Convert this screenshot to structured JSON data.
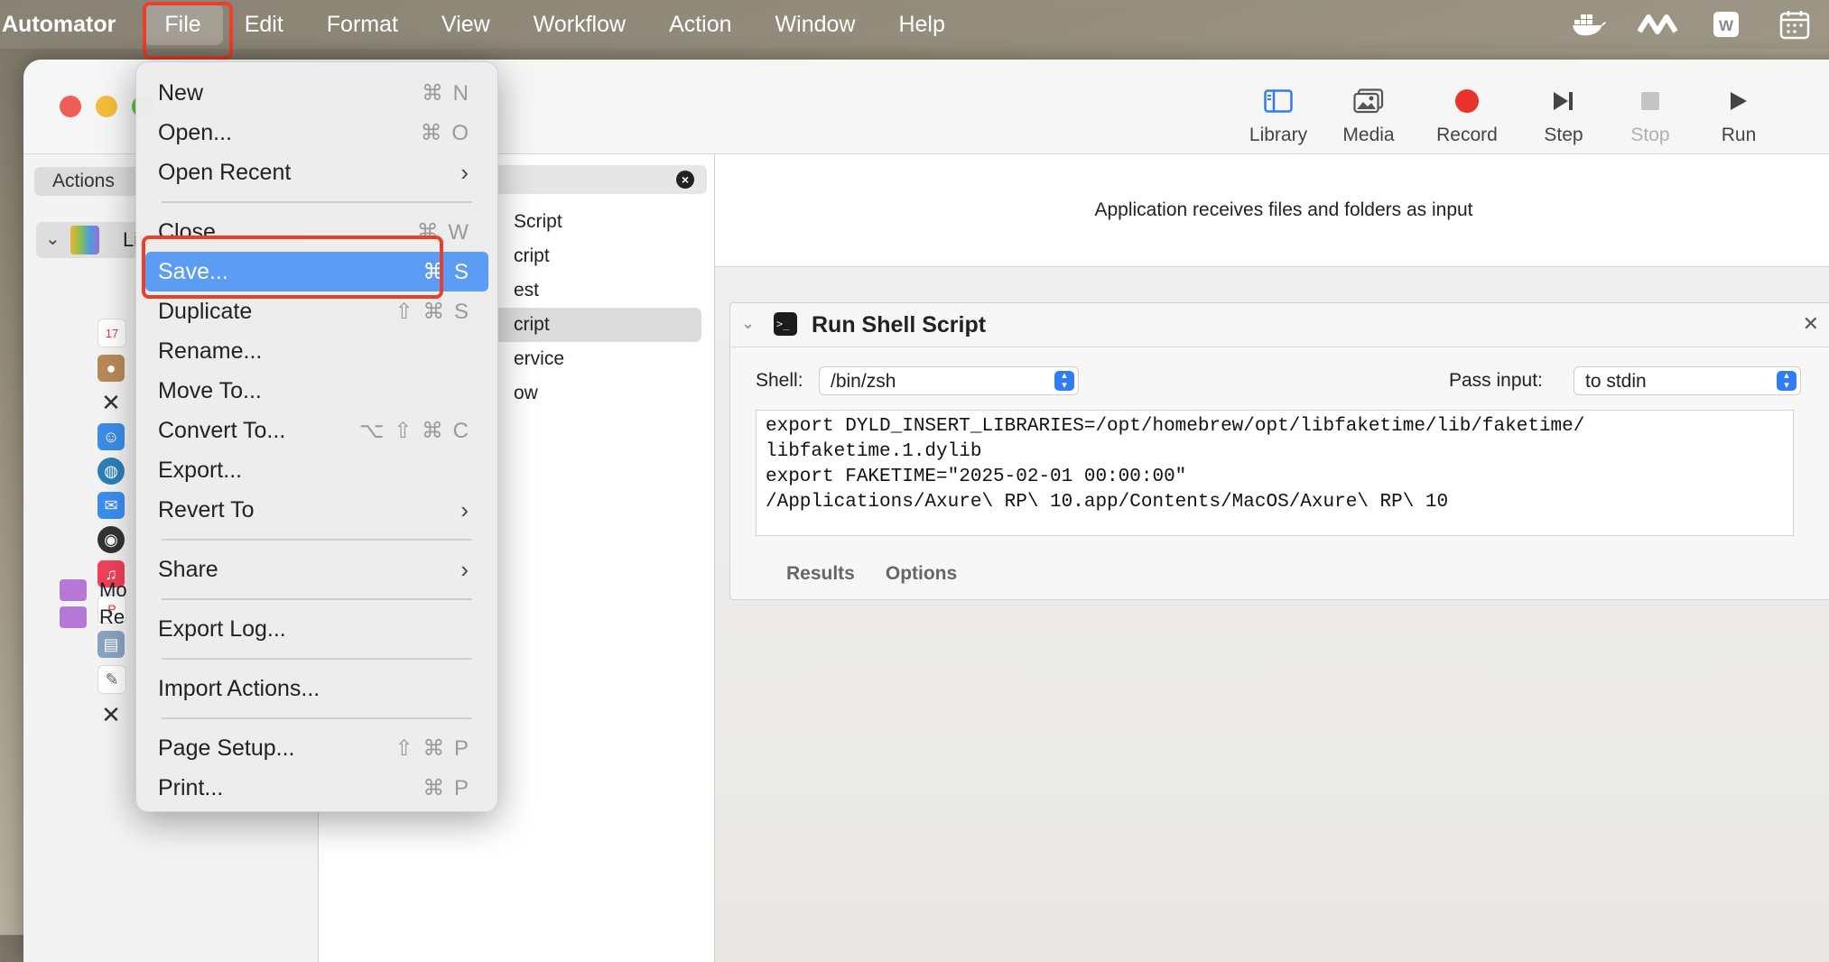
{
  "menubar": {
    "app_name": "Automator",
    "items": [
      "File",
      "Edit",
      "Format",
      "View",
      "Workflow",
      "Action",
      "Window",
      "Help"
    ],
    "status_icons": [
      "docker-icon",
      "creative-cloud-icon",
      "wps-icon",
      "calendar-icon"
    ]
  },
  "window": {
    "toolbar": {
      "library": "Library",
      "media": "Media",
      "record": "Record",
      "step": "Step",
      "stop": "Stop",
      "run": "Run"
    },
    "left": {
      "segment_label": "Actions",
      "library_label": "Lib",
      "folders": [
        "Mo",
        "Re"
      ]
    },
    "middle": {
      "items": [
        "Script",
        "cript",
        "est",
        "cript",
        "ervice",
        "ow"
      ],
      "selected_index": 3
    },
    "workflow": {
      "receives_text": "Application receives files and folders as input",
      "action": {
        "title": "Run Shell Script",
        "shell_label": "Shell:",
        "shell_value": "/bin/zsh",
        "pass_label": "Pass input:",
        "pass_value": "to stdin",
        "code": "export DYLD_INSERT_LIBRARIES=/opt/homebrew/opt/libfaketime/lib/faketime/\nlibfaketime.1.dylib\nexport FAKETIME=\"2025-02-01 00:00:00\"\n/Applications/Axure\\ RP\\ 10.app/Contents/MacOS/Axure\\ RP\\ 10",
        "tab_results": "Results",
        "tab_options": "Options"
      }
    }
  },
  "file_menu": {
    "items": [
      {
        "label": "New",
        "shortcut": "⌘ N"
      },
      {
        "label": "Open...",
        "shortcut": "⌘ O"
      },
      {
        "label": "Open Recent",
        "submenu": true
      },
      {
        "label": "Close",
        "shortcut": "⌘ W"
      },
      {
        "label": "Save...",
        "shortcut": "⌘ S",
        "selected": true
      },
      {
        "label": "Duplicate",
        "shortcut": "⇧ ⌘ S"
      },
      {
        "label": "Rename..."
      },
      {
        "label": "Move To..."
      },
      {
        "label": "Convert To...",
        "shortcut": "⌥ ⇧ ⌘ C"
      },
      {
        "label": "Export..."
      },
      {
        "label": "Revert To",
        "submenu": true
      },
      {
        "label": "Share",
        "submenu": true
      },
      {
        "label": "Export Log..."
      },
      {
        "label": "Import Actions..."
      },
      {
        "label": "Page Setup...",
        "shortcut": "⇧ ⌘ P"
      },
      {
        "label": "Print...",
        "shortcut": "⌘ P"
      }
    ],
    "submenu_arrow": "›"
  },
  "colors": {
    "highlight_box": "#e8402c",
    "menu_selection": "#5b9cf5",
    "record": "#e8322a",
    "accent": "#2f7cf6"
  }
}
